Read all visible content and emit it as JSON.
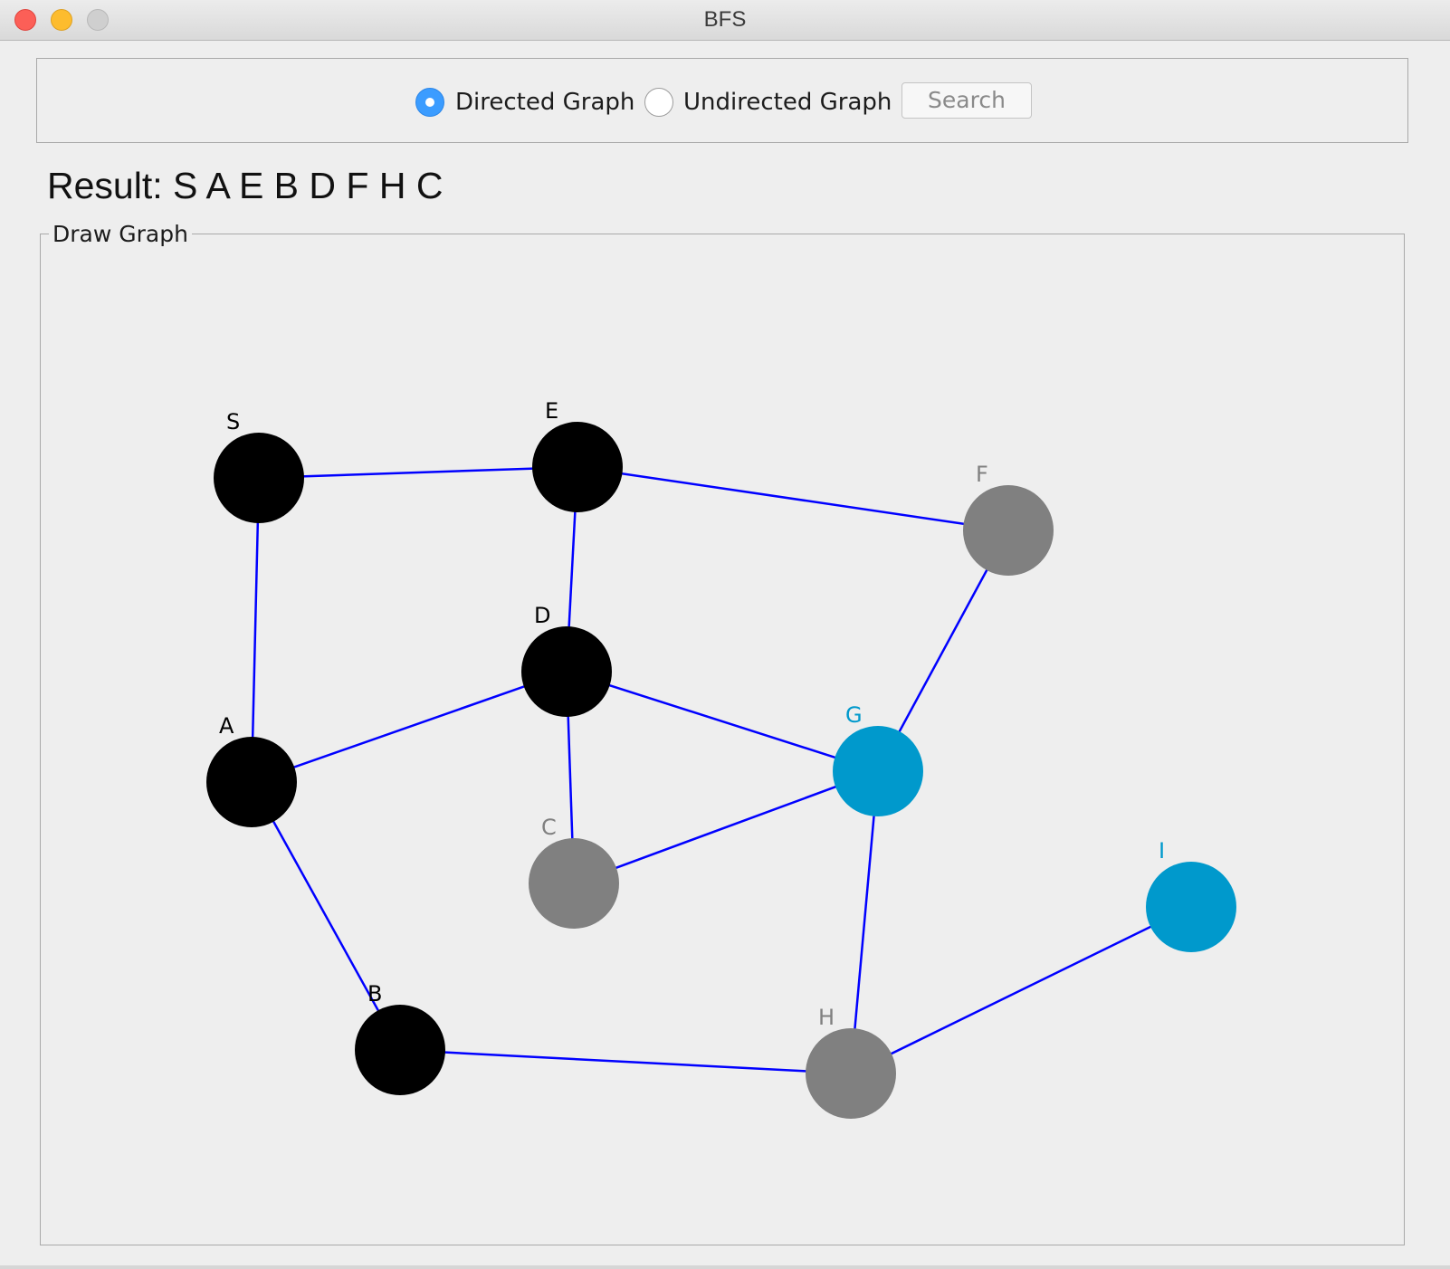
{
  "window": {
    "title": "BFS"
  },
  "toolbar": {
    "options": [
      {
        "label": "Directed Graph",
        "selected": true
      },
      {
        "label": "Undirected Graph",
        "selected": false
      }
    ],
    "search_label": "Search"
  },
  "result": {
    "text": "Result: S A E B D F H C"
  },
  "draw_panel": {
    "title": "Draw Graph"
  },
  "colors": {
    "visited": "#000000",
    "frontier": "#808080",
    "unvisited": "#0099cc",
    "edge": "#0000ff",
    "accent": "#3b9cff"
  },
  "graph": {
    "nodes": [
      {
        "id": "S",
        "label": "S",
        "state": "visited"
      },
      {
        "id": "E",
        "label": "E",
        "state": "visited"
      },
      {
        "id": "F",
        "label": "F",
        "state": "frontier"
      },
      {
        "id": "D",
        "label": "D",
        "state": "visited"
      },
      {
        "id": "A",
        "label": "A",
        "state": "visited"
      },
      {
        "id": "G",
        "label": "G",
        "state": "unvisited"
      },
      {
        "id": "C",
        "label": "C",
        "state": "frontier"
      },
      {
        "id": "I",
        "label": "I",
        "state": "unvisited"
      },
      {
        "id": "B",
        "label": "B",
        "state": "visited"
      },
      {
        "id": "H",
        "label": "H",
        "state": "frontier"
      }
    ],
    "edges": [
      {
        "from": "S",
        "to": "E"
      },
      {
        "from": "S",
        "to": "A"
      },
      {
        "from": "E",
        "to": "F"
      },
      {
        "from": "E",
        "to": "D"
      },
      {
        "from": "A",
        "to": "D"
      },
      {
        "from": "A",
        "to": "B"
      },
      {
        "from": "D",
        "to": "G"
      },
      {
        "from": "D",
        "to": "C"
      },
      {
        "from": "C",
        "to": "G"
      },
      {
        "from": "G",
        "to": "F"
      },
      {
        "from": "G",
        "to": "H"
      },
      {
        "from": "B",
        "to": "H"
      },
      {
        "from": "H",
        "to": "I"
      }
    ]
  }
}
